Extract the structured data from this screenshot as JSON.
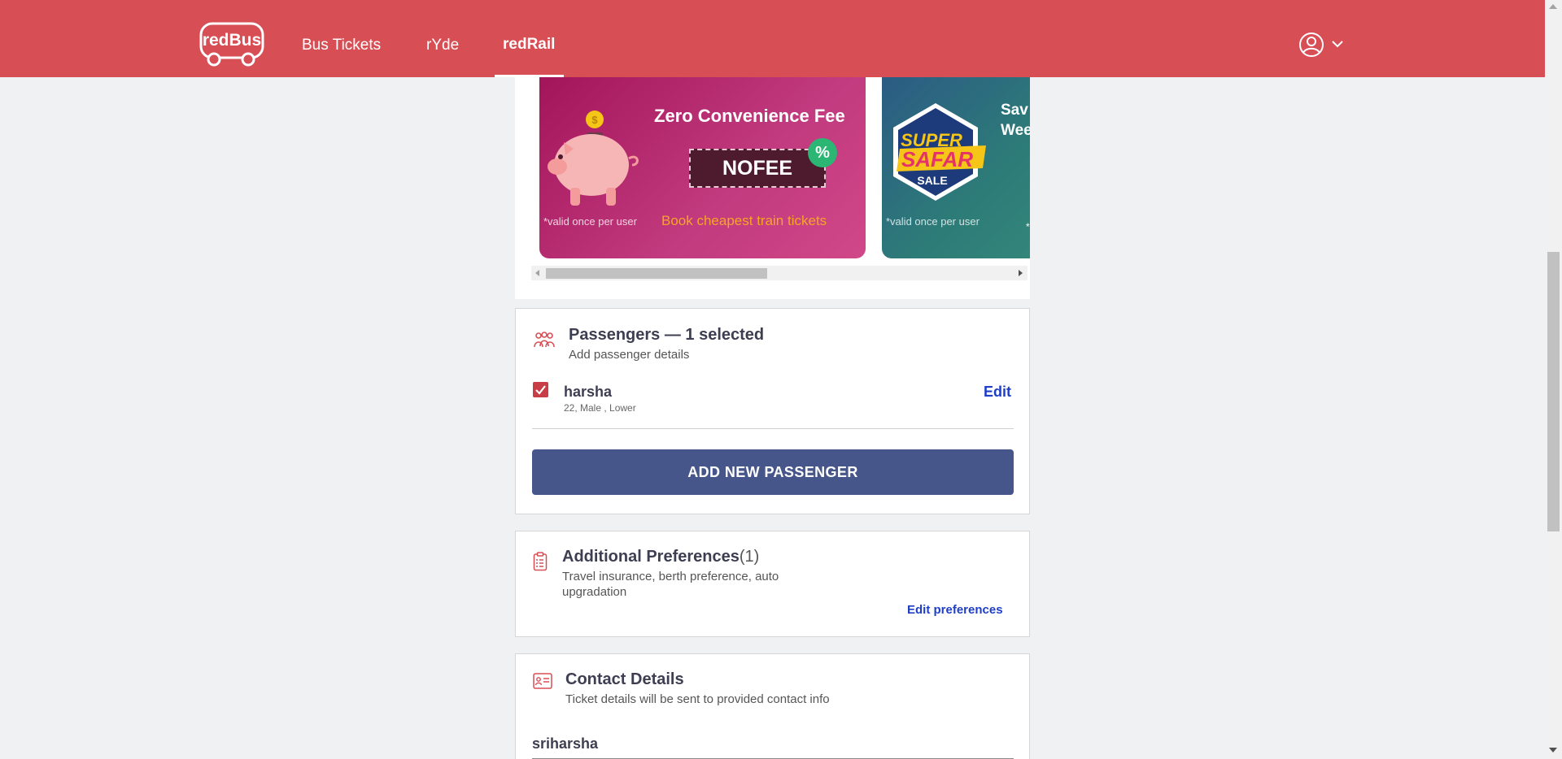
{
  "header": {
    "logo_text": "redBus",
    "nav": [
      {
        "label": "Bus Tickets"
      },
      {
        "label": "rYde"
      },
      {
        "label": "redRail"
      }
    ],
    "active_nav": "redRail",
    "colors": {
      "brand": "#d84e55",
      "accent_blue": "#1e3ec8",
      "button_blue": "#46568a"
    }
  },
  "offers": [
    {
      "title": "Zero Convenience Fee",
      "code": "NOFEE",
      "subtitle": "Book cheapest train tickets",
      "valid_note": "*valid once per user",
      "badge": "%",
      "image_icon": "piggy-bank-icon"
    },
    {
      "title_line1": "Sav",
      "title_line2": "Wee",
      "logo_words": [
        "SUPER",
        "SAFAR",
        "SALE"
      ],
      "valid_note": "*valid once per user",
      "trailing_mark": "*",
      "image_icon": "super-safar-sale-badge"
    }
  ],
  "passengers": {
    "title": "Passengers — 1  selected",
    "subtitle": "Add passenger details",
    "list": [
      {
        "name": "harsha",
        "meta": "22, Male , Lower",
        "checked": true,
        "edit_label": "Edit"
      }
    ],
    "add_button": "ADD NEW PASSENGER"
  },
  "preferences": {
    "title": "Additional Preferences",
    "count": "(1)",
    "subtitle_line1": "Travel insurance, berth preference, auto",
    "subtitle_line2": "upgradation",
    "edit_label": "Edit preferences"
  },
  "contact": {
    "title": "Contact Details",
    "subtitle": "Ticket details will be sent to provided contact info",
    "name_value": "sriharsha"
  }
}
